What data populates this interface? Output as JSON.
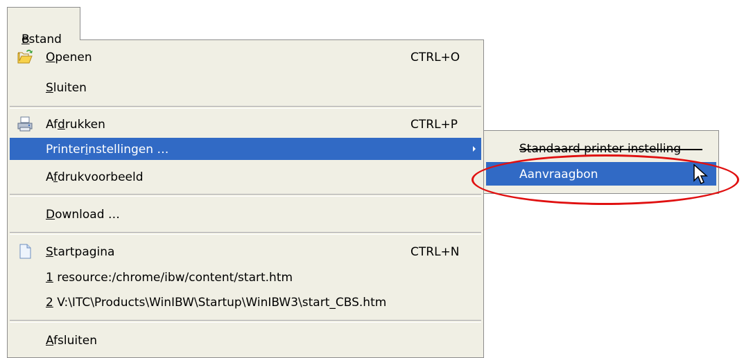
{
  "menubar": {
    "file_prefix": "B",
    "file_rest": "estand"
  },
  "menu": {
    "open": {
      "prefix": "",
      "ul": "O",
      "rest": "penen",
      "shortcut": "CTRL+O",
      "icon": "open-folder-icon"
    },
    "close": {
      "prefix": "",
      "ul": "S",
      "rest": "luiten"
    },
    "print": {
      "prefix": "Af",
      "ul": "d",
      "rest": "rukken",
      "shortcut": "CTRL+P",
      "icon": "printer-icon"
    },
    "printer_settings": {
      "prefix": "Printer",
      "ul": "i",
      "rest": "nstellingen …"
    },
    "print_preview": {
      "prefix": "A",
      "ul": "f",
      "rest": "drukvoorbeeld"
    },
    "download": {
      "prefix": "",
      "ul": "D",
      "rest": "ownload …"
    },
    "home": {
      "prefix": "",
      "ul": "S",
      "rest": "tartpagina",
      "shortcut": "CTRL+N",
      "icon": "page-icon"
    },
    "recent1": {
      "ul": "1",
      "rest": " resource:/chrome/ibw/content/start.htm"
    },
    "recent2": {
      "ul": "2",
      "rest": " V:\\ITC\\Products\\WinIBW\\Startup\\WinIBW3\\start_CBS.htm"
    },
    "exit": {
      "prefix": "",
      "ul": "A",
      "rest": "fsluiten"
    }
  },
  "submenu": {
    "default_printer": "Standaard printer instelling",
    "request_form": "Aanvraagbon"
  },
  "colors": {
    "highlight": "#316ac5",
    "menu_bg": "#f0efe4",
    "annotation": "#e01010"
  }
}
